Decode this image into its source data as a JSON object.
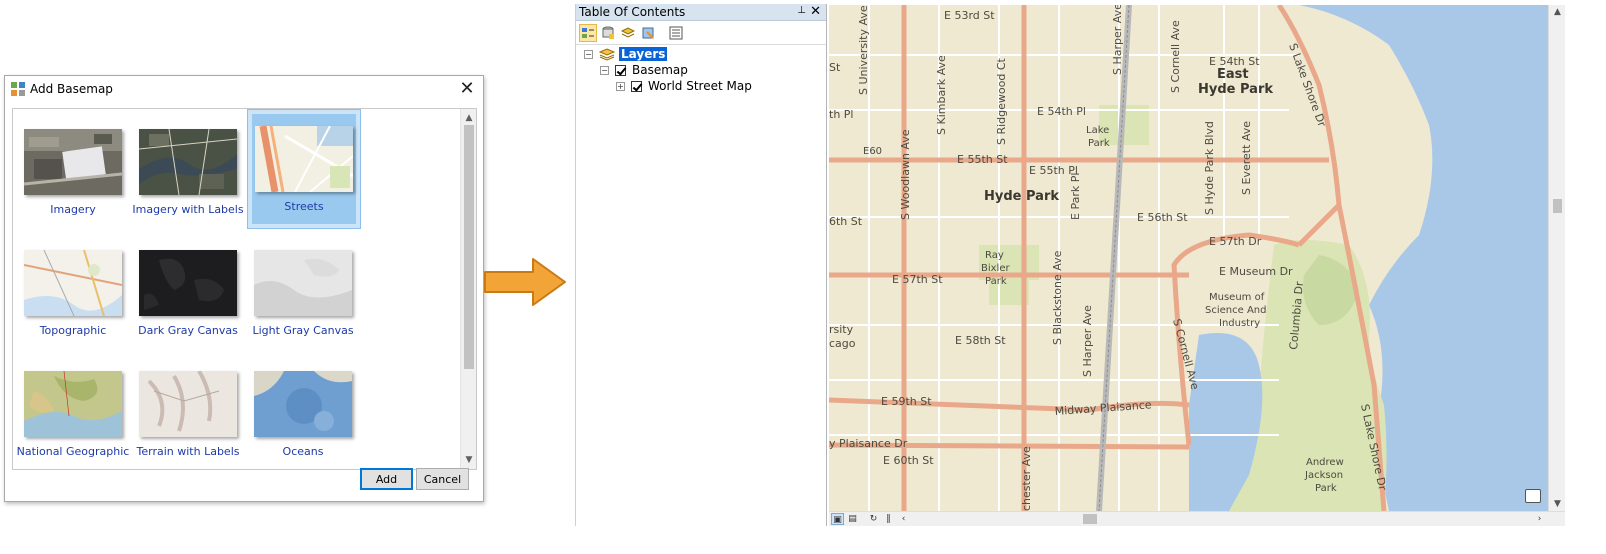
{
  "dialog": {
    "title": "Add Basemap",
    "close_glyph": "✕",
    "tiles": [
      {
        "label": "Imagery",
        "thumb": "imagery"
      },
      {
        "label": "Imagery with Labels",
        "thumb": "imagery-labels"
      },
      {
        "label": "Streets",
        "thumb": "streets",
        "selected": true
      },
      {
        "label": "Topographic",
        "thumb": "topographic"
      },
      {
        "label": "Dark Gray Canvas",
        "thumb": "dark-gray"
      },
      {
        "label": "Light Gray Canvas",
        "thumb": "light-gray"
      },
      {
        "label": "National Geographic",
        "thumb": "natgeo"
      },
      {
        "label": "Terrain with Labels",
        "thumb": "terrain"
      },
      {
        "label": "Oceans",
        "thumb": "oceans"
      }
    ],
    "add_label": "Add",
    "cancel_label": "Cancel"
  },
  "toc": {
    "title": "Table Of Contents",
    "pin_glyph": "⊥",
    "close_glyph": "✕",
    "tree": {
      "layers": "Layers",
      "basemap": "Basemap",
      "world_street_map": "World Street Map"
    }
  },
  "map": {
    "labels": {
      "e53rd": "E 53rd St",
      "univ": "S University Ave",
      "harper_top": "S Harper Ave",
      "cornell_top": "S Cornell Ave",
      "e54th_st": "E 54th St",
      "east_hyde_park_1": "East",
      "east_hyde_park_2": "Hyde Park",
      "lake_shore_top": "S Lake Shore Dr",
      "kimbark": "S Kimbark Ave",
      "ridgewood": "S Ridgewood Ct",
      "e54th_pl": "E 54th Pl",
      "lake_park_1": "Lake",
      "lake_park_2": "Park",
      "e55th_st": "E 55th St",
      "e55th_pl": "E 55th Pl",
      "e60": "E60",
      "hyde_park_blvd": "S Hyde Park Blvd",
      "everett": "S Everett Ave",
      "woodlawn": "S Woodlawn Ave",
      "hyde_park": "Hyde Park",
      "park_pl": "E Park Pl",
      "e56th_st": "E 56th St",
      "sixth_st": "6th St",
      "e57th_dr": "E 57th Dr",
      "ray_1": "Ray",
      "ray_2": "Bixler",
      "ray_3": "Park",
      "e57th_st": "E 57th St",
      "blackstone": "S Blackstone Ave",
      "museum_dr": "E Museum Dr",
      "msi_1": "Museum of",
      "msi_2": "Science And",
      "msi_3": "Industry",
      "columbia": "Columbia Dr",
      "harper_bottom": "S Harper Ave",
      "cornell_bottom": "S Cornell Ave",
      "e58th": "E 58th St",
      "rsity": "rsity",
      "cago": "cago",
      "e59th": "E 59th St",
      "midway": "Midway Plaisance",
      "plaisance_dr": "y Plaisance Dr",
      "e60th": "E 60th St",
      "chester": "chester Ave",
      "lake_shore_bottom": "S Lake Shore Dr",
      "jackson_1": "Andrew",
      "jackson_2": "Jackson",
      "jackson_3": "Park",
      "th_pl": "th Pl",
      "st_left": "St"
    }
  }
}
